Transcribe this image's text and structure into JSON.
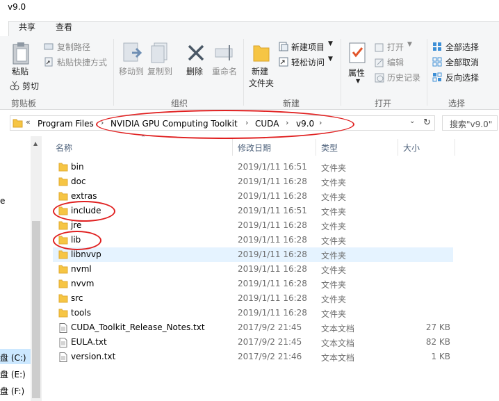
{
  "window": {
    "title": "v9.0"
  },
  "tabs": [
    {
      "label": "共享"
    },
    {
      "label": "查看"
    }
  ],
  "ribbon": {
    "clipboard": {
      "group_label": "剪贴板",
      "paste": "粘贴",
      "cut": "剪切",
      "copy_path": "复制路径",
      "paste_shortcut": "粘贴快捷方式"
    },
    "organize": {
      "group_label": "组织",
      "move_to": "移动到",
      "copy_to": "复制到",
      "delete": "删除",
      "rename": "重命名"
    },
    "new": {
      "group_label": "新建",
      "new_folder": "新建\n文件夹",
      "new_item": "新建项目",
      "easy_access": "轻松访问"
    },
    "open": {
      "group_label": "打开",
      "properties": "属性",
      "open": "打开",
      "edit": "编辑",
      "history": "历史记录"
    },
    "select": {
      "group_label": "选择",
      "select_all": "全部选择",
      "select_none": "全部取消",
      "invert": "反向选择"
    }
  },
  "address": {
    "overflow": "«",
    "crumbs": [
      "Program Files",
      "NVIDIA GPU Computing Toolkit",
      "CUDA",
      "v9.0"
    ],
    "search_placeholder": "搜索\"v9.0\""
  },
  "nav": {
    "items": [
      "e",
      "盘 (C:)",
      "盘 (E:)",
      "盘 (F:)"
    ]
  },
  "columns": {
    "name": "名称",
    "date": "修改日期",
    "type": "类型",
    "size": "大小"
  },
  "files": [
    {
      "name": "bin",
      "date": "2019/1/11 16:51",
      "type": "文件夹",
      "size": "",
      "kind": "folder"
    },
    {
      "name": "doc",
      "date": "2019/1/11 16:28",
      "type": "文件夹",
      "size": "",
      "kind": "folder"
    },
    {
      "name": "extras",
      "date": "2019/1/11 16:28",
      "type": "文件夹",
      "size": "",
      "kind": "folder"
    },
    {
      "name": "include",
      "date": "2019/1/11 16:51",
      "type": "文件夹",
      "size": "",
      "kind": "folder"
    },
    {
      "name": "jre",
      "date": "2019/1/11 16:28",
      "type": "文件夹",
      "size": "",
      "kind": "folder"
    },
    {
      "name": "lib",
      "date": "2019/1/11 16:28",
      "type": "文件夹",
      "size": "",
      "kind": "folder"
    },
    {
      "name": "libnvvp",
      "date": "2019/1/11 16:28",
      "type": "文件夹",
      "size": "",
      "kind": "folder"
    },
    {
      "name": "nvml",
      "date": "2019/1/11 16:28",
      "type": "文件夹",
      "size": "",
      "kind": "folder"
    },
    {
      "name": "nvvm",
      "date": "2019/1/11 16:28",
      "type": "文件夹",
      "size": "",
      "kind": "folder"
    },
    {
      "name": "src",
      "date": "2019/1/11 16:28",
      "type": "文件夹",
      "size": "",
      "kind": "folder"
    },
    {
      "name": "tools",
      "date": "2019/1/11 16:28",
      "type": "文件夹",
      "size": "",
      "kind": "folder"
    },
    {
      "name": "CUDA_Toolkit_Release_Notes.txt",
      "date": "2017/9/2 21:45",
      "type": "文本文档",
      "size": "27 KB",
      "kind": "file"
    },
    {
      "name": "EULA.txt",
      "date": "2017/9/2 21:45",
      "type": "文本文档",
      "size": "82 KB",
      "kind": "file"
    },
    {
      "name": "version.txt",
      "date": "2017/9/2 21:46",
      "type": "文本文档",
      "size": "1 KB",
      "kind": "file"
    }
  ],
  "colors": {
    "highlight_circle": "#e02020",
    "folder": "#f6c544",
    "hover_row": "#e5f3ff",
    "selected_nav": "#cce8ff"
  }
}
